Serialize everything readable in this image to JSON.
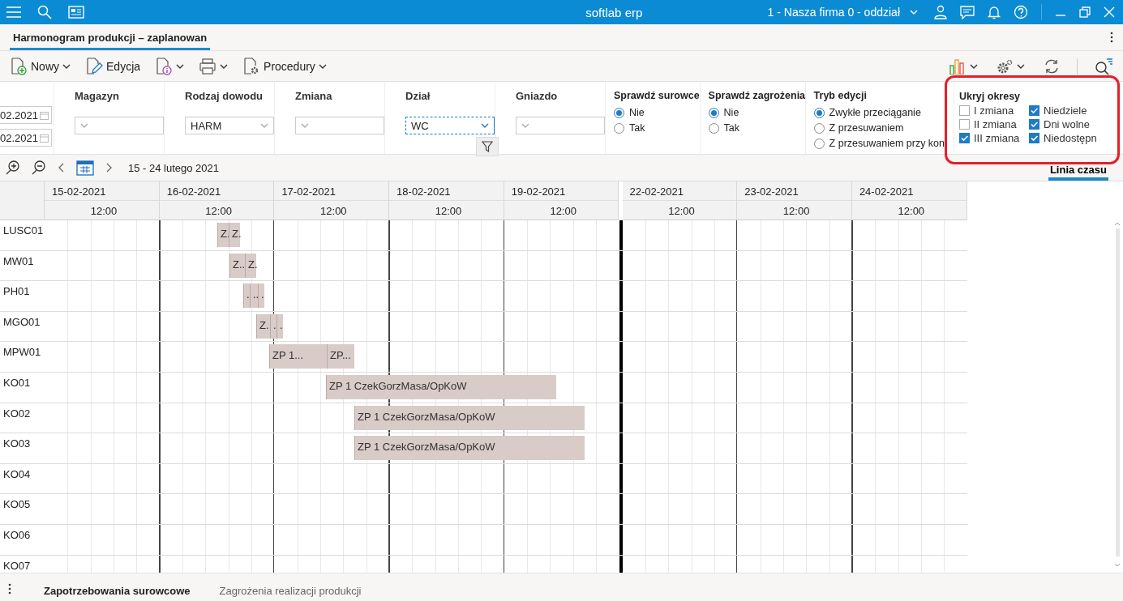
{
  "title_bar": {
    "app_title": "softlab erp",
    "company": "1 - Nasza firma 0 - oddział"
  },
  "document_tabs": [
    {
      "label": "Harmonogram produkcji – zaplanowan",
      "selected": true
    }
  ],
  "toolbar": {
    "buttons": [
      {
        "kind": "new",
        "label": "Nowy",
        "dropdown": true
      },
      {
        "kind": "edit",
        "label": "Edycja",
        "dropdown": false
      },
      {
        "kind": "info",
        "dropdown": true
      },
      {
        "kind": "print",
        "dropdown": true
      },
      {
        "kind": "procedures",
        "label": "Procedury",
        "dropdown": true
      }
    ],
    "right_tools": [
      {
        "kind": "chart",
        "dropdown": true
      },
      {
        "kind": "gear",
        "dropdown": true
      },
      {
        "kind": "refresh",
        "dropdown": false
      },
      {
        "kind": "search",
        "dropdown": false
      }
    ]
  },
  "filters": {
    "dates": [
      "02.2021",
      "02.2021"
    ],
    "fields": [
      {
        "label": "Magazyn",
        "focused": false
      },
      {
        "label": "Rodzaj dowodu",
        "value": "HARM",
        "focused": false
      },
      {
        "label": "Zmiana",
        "focused": false
      },
      {
        "label": "Dział",
        "value": "WC",
        "focused": true
      },
      {
        "label": "Gniazdo",
        "focused": false
      }
    ],
    "radio_groups": [
      {
        "title": "Sprawdź surowce",
        "options": [
          {
            "label": "Nie",
            "selected": true
          },
          {
            "label": "Tak",
            "selected": false
          }
        ]
      },
      {
        "title": "Sprawdź zagrożenia",
        "options": [
          {
            "label": "Nie",
            "selected": true
          },
          {
            "label": "Tak",
            "selected": false
          }
        ]
      },
      {
        "title": "Tryb edycji",
        "options": [
          {
            "label": "Zwykłe przeciąganie",
            "selected": true
          },
          {
            "label": "Z przesuwaniem",
            "selected": false
          },
          {
            "label": "Z przesuwaniem przy kon",
            "selected": false
          }
        ]
      }
    ],
    "hide_periods": {
      "title": "Ukryj okresy",
      "options": [
        {
          "label": "I zmiana",
          "checked": false
        },
        {
          "label": "Niedziele",
          "checked": true
        },
        {
          "label": "II zmiana",
          "checked": false
        },
        {
          "label": "Dni wolne",
          "checked": true
        },
        {
          "label": "III zmiana",
          "checked": true
        },
        {
          "label": "Niedostępn",
          "checked": true
        }
      ]
    }
  },
  "timeline_nav": {
    "range": "15 - 24 lutego 2021",
    "view_tab": {
      "label": "Linia czasu",
      "selected": true
    }
  },
  "gantt": {
    "days": [
      {
        "date": "15-02-2021",
        "time": "12:00"
      },
      {
        "date": "16-02-2021",
        "time": "12:00",
        "week_break": false
      },
      {
        "date": "17-02-2021",
        "time": "12:00",
        "week_break": false
      },
      {
        "date": "18-02-2021",
        "time": "12:00",
        "week_break": false
      },
      {
        "date": "19-02-2021",
        "time": "12:00",
        "week_break": false
      },
      {
        "date": "22-02-2021",
        "time": "12:00",
        "week_break": true
      },
      {
        "date": "23-02-2021",
        "time": "12:00",
        "week_break": false
      },
      {
        "date": "24-02-2021",
        "time": "12:00",
        "week_break": false
      }
    ],
    "rows": [
      {
        "name": "LUSC01",
        "tasks": [
          {
            "label": "Z."
          },
          {
            "label": "Z."
          }
        ]
      },
      {
        "name": "MW01",
        "tasks": [
          {
            "label": "Z.."
          },
          {
            "label": "Z."
          }
        ]
      },
      {
        "name": "PH01",
        "tasks": [
          {
            "label": "."
          },
          {
            "label": ".."
          },
          {
            "label": "."
          }
        ]
      },
      {
        "name": "MGO01",
        "tasks": [
          {
            "label": "Z."
          },
          {
            "label": "."
          },
          {
            "label": "."
          }
        ]
      },
      {
        "name": "MPW01",
        "tasks": [
          {
            "label": "ZP 1..."
          },
          {
            "label": "ZP..."
          }
        ]
      },
      {
        "name": "KO01",
        "tasks": [
          {
            "label": "ZP 1 CzekGorzMasa/OpKoW"
          }
        ]
      },
      {
        "name": "KO02",
        "tasks": [
          {
            "label": "ZP 1 CzekGorzMasa/OpKoW"
          }
        ]
      },
      {
        "name": "KO03",
        "tasks": [
          {
            "label": "ZP 1 CzekGorzMasa/OpKoW"
          }
        ]
      },
      {
        "name": "KO04"
      },
      {
        "name": "KO05"
      },
      {
        "name": "KO06"
      },
      {
        "name": "KO07"
      }
    ]
  },
  "bottom_tabs": [
    {
      "label": "Zapotrzebowania surowcowe",
      "selected": true
    },
    {
      "label": "Zagrożenia realizacji produkcji",
      "selected": false
    }
  ]
}
